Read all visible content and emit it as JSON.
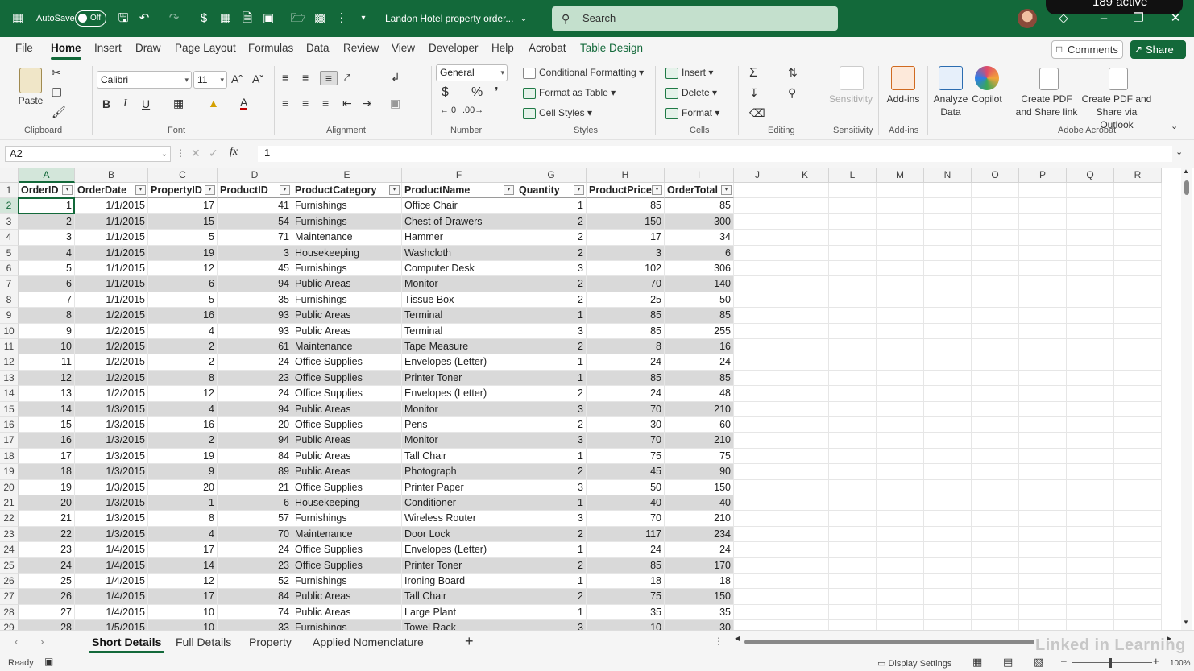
{
  "titlebar": {
    "autosave_label": "AutoSave",
    "autosave_state": "Off",
    "doc_title": "Landon Hotel property order...",
    "search_placeholder": "Search",
    "active_badge": "189 active"
  },
  "menu": [
    "File",
    "Home",
    "Insert",
    "Draw",
    "Page Layout",
    "Formulas",
    "Data",
    "Review",
    "View",
    "Developer",
    "Help",
    "Acrobat",
    "Table Design"
  ],
  "menu_active": "Home",
  "actions": {
    "comments": "Comments",
    "share": "Share"
  },
  "ribbon": {
    "clipboard": {
      "paste": "Paste",
      "label": "Clipboard"
    },
    "font": {
      "name": "Calibri",
      "size": "11",
      "label": "Font",
      "bold": "B",
      "italic": "I",
      "underline": "U"
    },
    "alignment": {
      "label": "Alignment"
    },
    "number": {
      "format": "General",
      "label": "Number"
    },
    "styles": {
      "conditional": "Conditional Formatting",
      "format_table": "Format as Table",
      "cell_styles": "Cell Styles",
      "label": "Styles"
    },
    "cells": {
      "insert": "Insert",
      "delete": "Delete",
      "format": "Format",
      "label": "Cells"
    },
    "editing": {
      "label": "Editing"
    },
    "sensitivity": {
      "button": "Sensitivity",
      "label": "Sensitivity"
    },
    "addins": {
      "button": "Add-ins",
      "label": "Add-ins"
    },
    "analyze": {
      "line1": "Analyze",
      "line2": "Data"
    },
    "copilot": {
      "button": "Copilot"
    },
    "acrobat": {
      "pdf_link_1": "Create PDF",
      "pdf_link_2": "and Share link",
      "pdf_outlook_1": "Create PDF and",
      "pdf_outlook_2": "Share via Outlook",
      "label": "Adobe Acrobat"
    }
  },
  "formula": {
    "namebox": "A2",
    "fx": "fx",
    "value": "1"
  },
  "sheet": {
    "columns": [
      "A",
      "B",
      "C",
      "D",
      "E",
      "F",
      "G",
      "H",
      "I",
      "J",
      "K",
      "L",
      "M",
      "N",
      "O",
      "P",
      "Q",
      "R"
    ],
    "row_numbers": [
      "1",
      "2",
      "3",
      "4",
      "5",
      "6",
      "7",
      "8",
      "9",
      "10",
      "11",
      "12",
      "13",
      "14",
      "15",
      "16",
      "17",
      "18",
      "19",
      "20",
      "21",
      "22",
      "23",
      "24",
      "25",
      "26",
      "27",
      "28",
      "29"
    ],
    "headers": [
      "OrderID",
      "OrderDate",
      "PropertyID",
      "ProductID",
      "ProductCategory",
      "ProductName",
      "Quantity",
      "ProductPrice",
      "OrderTotal"
    ],
    "rows": [
      [
        "1",
        "1/1/2015",
        "17",
        "41",
        "Furnishings",
        "Office Chair",
        "1",
        "85",
        "85"
      ],
      [
        "2",
        "1/1/2015",
        "15",
        "54",
        "Furnishings",
        "Chest of Drawers",
        "2",
        "150",
        "300"
      ],
      [
        "3",
        "1/1/2015",
        "5",
        "71",
        "Maintenance",
        "Hammer",
        "2",
        "17",
        "34"
      ],
      [
        "4",
        "1/1/2015",
        "19",
        "3",
        "Housekeeping",
        "Washcloth",
        "2",
        "3",
        "6"
      ],
      [
        "5",
        "1/1/2015",
        "12",
        "45",
        "Furnishings",
        "Computer Desk",
        "3",
        "102",
        "306"
      ],
      [
        "6",
        "1/1/2015",
        "6",
        "94",
        "Public Areas",
        "Monitor",
        "2",
        "70",
        "140"
      ],
      [
        "7",
        "1/1/2015",
        "5",
        "35",
        "Furnishings",
        "Tissue Box",
        "2",
        "25",
        "50"
      ],
      [
        "8",
        "1/2/2015",
        "16",
        "93",
        "Public Areas",
        "Terminal",
        "1",
        "85",
        "85"
      ],
      [
        "9",
        "1/2/2015",
        "4",
        "93",
        "Public Areas",
        "Terminal",
        "3",
        "85",
        "255"
      ],
      [
        "10",
        "1/2/2015",
        "2",
        "61",
        "Maintenance",
        "Tape Measure",
        "2",
        "8",
        "16"
      ],
      [
        "11",
        "1/2/2015",
        "2",
        "24",
        "Office Supplies",
        "Envelopes (Letter)",
        "1",
        "24",
        "24"
      ],
      [
        "12",
        "1/2/2015",
        "8",
        "23",
        "Office Supplies",
        "Printer Toner",
        "1",
        "85",
        "85"
      ],
      [
        "13",
        "1/2/2015",
        "12",
        "24",
        "Office Supplies",
        "Envelopes (Letter)",
        "2",
        "24",
        "48"
      ],
      [
        "14",
        "1/3/2015",
        "4",
        "94",
        "Public Areas",
        "Monitor",
        "3",
        "70",
        "210"
      ],
      [
        "15",
        "1/3/2015",
        "16",
        "20",
        "Office Supplies",
        "Pens",
        "2",
        "30",
        "60"
      ],
      [
        "16",
        "1/3/2015",
        "2",
        "94",
        "Public Areas",
        "Monitor",
        "3",
        "70",
        "210"
      ],
      [
        "17",
        "1/3/2015",
        "19",
        "84",
        "Public Areas",
        "Tall Chair",
        "1",
        "75",
        "75"
      ],
      [
        "18",
        "1/3/2015",
        "9",
        "89",
        "Public Areas",
        "Photograph",
        "2",
        "45",
        "90"
      ],
      [
        "19",
        "1/3/2015",
        "20",
        "21",
        "Office Supplies",
        "Printer Paper",
        "3",
        "50",
        "150"
      ],
      [
        "20",
        "1/3/2015",
        "1",
        "6",
        "Housekeeping",
        "Conditioner",
        "1",
        "40",
        "40"
      ],
      [
        "21",
        "1/3/2015",
        "8",
        "57",
        "Furnishings",
        "Wireless Router",
        "3",
        "70",
        "210"
      ],
      [
        "22",
        "1/3/2015",
        "4",
        "70",
        "Maintenance",
        "Door Lock",
        "2",
        "117",
        "234"
      ],
      [
        "23",
        "1/4/2015",
        "17",
        "24",
        "Office Supplies",
        "Envelopes (Letter)",
        "1",
        "24",
        "24"
      ],
      [
        "24",
        "1/4/2015",
        "14",
        "23",
        "Office Supplies",
        "Printer Toner",
        "2",
        "85",
        "170"
      ],
      [
        "25",
        "1/4/2015",
        "12",
        "52",
        "Furnishings",
        "Ironing Board",
        "1",
        "18",
        "18"
      ],
      [
        "26",
        "1/4/2015",
        "17",
        "84",
        "Public Areas",
        "Tall Chair",
        "2",
        "75",
        "150"
      ],
      [
        "27",
        "1/4/2015",
        "10",
        "74",
        "Public Areas",
        "Large Plant",
        "1",
        "35",
        "35"
      ],
      [
        "28",
        "1/5/2015",
        "10",
        "33",
        "Furnishings",
        "Towel Rack",
        "3",
        "10",
        "30"
      ]
    ]
  },
  "tabs": [
    "Short Details",
    "Full Details",
    "Property",
    "Applied Nomenclature"
  ],
  "tab_active": "Short Details",
  "status": {
    "ready": "Ready",
    "display_settings": "Display Settings",
    "zoom": "100%"
  },
  "watermark": "Linked in Learning",
  "colors": {
    "excel_green": "#13693a",
    "band": "#d9d9d9"
  }
}
